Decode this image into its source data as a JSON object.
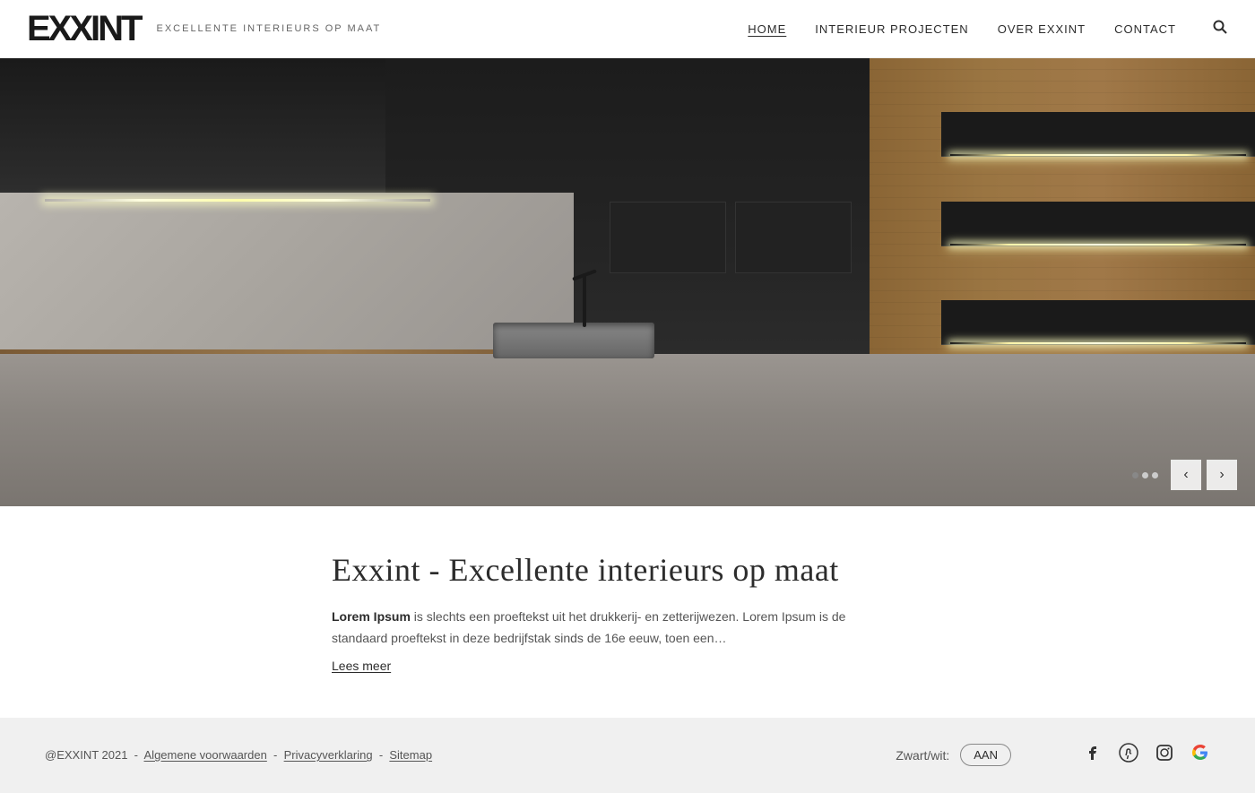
{
  "header": {
    "logo": "EXXINT",
    "tagline": "EXCELLENTE INTERIEURS OP MAAT",
    "nav": {
      "home": "HOME",
      "projects": "INTERIEUR PROJECTEN",
      "about": "OVER EXXINT",
      "contact": "CONTACT"
    }
  },
  "hero": {
    "dots": [
      "dot1",
      "dot2",
      "dot3"
    ],
    "prev_label": "‹",
    "next_label": "›"
  },
  "content": {
    "title": "Exxint - Excellente interieurs op maat",
    "intro_bold": "Lorem Ipsum",
    "intro_text": " is slechts een proeftekst uit het drukkerij- en zetterijwezen. Lorem Ipsum is de standaard proeftekst in deze bedrijfstak sinds de 16e eeuw, toen een…",
    "read_more": "Lees meer"
  },
  "footer": {
    "copyright": "@EXXINT 2021",
    "links": {
      "terms": "Algemene voorwaarden",
      "privacy": "Privacyverklaring",
      "sitemap": "Sitemap"
    },
    "theme_label": "Zwart/wit:",
    "theme_toggle": "AAN",
    "social": {
      "facebook": "f",
      "pinterest": "𝗣",
      "instagram": "◻",
      "google": "G"
    }
  }
}
